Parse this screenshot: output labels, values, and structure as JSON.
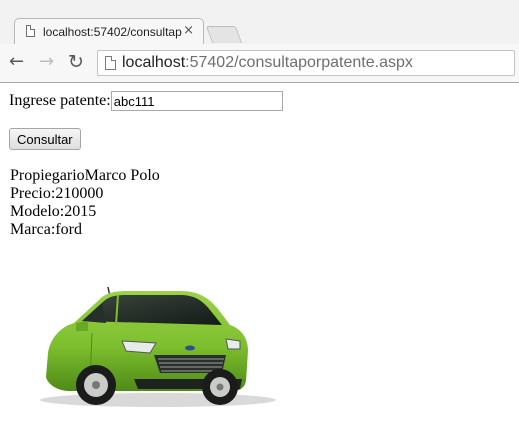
{
  "browser": {
    "tab": {
      "title": "localhost:57402/consultap",
      "close_glyph": "×",
      "icon": "page-icon"
    },
    "nav": {
      "back_glyph": "←",
      "forward_glyph": "→",
      "reload_glyph": "↻"
    },
    "address": {
      "host": "localhost",
      "rest": ":57402/consultaporpatente.aspx",
      "icon": "page-icon"
    }
  },
  "form": {
    "label": "Ingrese patente:",
    "input_value": "abc111",
    "submit_label": "Consultar"
  },
  "result": {
    "owner_label": "Propiegario",
    "owner_value": "Marco Polo",
    "price_label": "Precio:",
    "price_value": "210000",
    "model_label": "Modelo:",
    "model_value": "2015",
    "brand_label": "Marca:",
    "brand_value": "ford"
  },
  "colors": {
    "car_body": "#7dbf2e",
    "car_body_dark": "#4f8a18",
    "window": "#1f2a22"
  }
}
